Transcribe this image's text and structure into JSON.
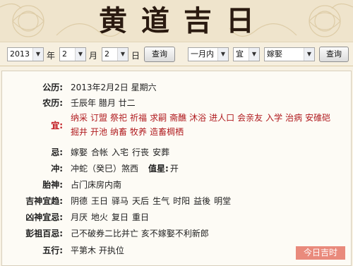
{
  "header": {
    "title": "黄道吉日"
  },
  "query": {
    "year": "2013",
    "year_unit": "年",
    "month": "2",
    "month_unit": "月",
    "day": "2",
    "day_unit": "日",
    "query_button": "查询",
    "range": "一月内",
    "type": "宜",
    "event": "嫁娶",
    "query_button2": "查询"
  },
  "result": {
    "gongli": {
      "label": "公历:",
      "value": "2013年2月2日 星期六"
    },
    "nongli": {
      "label": "农历:",
      "value": "壬辰年 腊月 廿二"
    },
    "yi": {
      "label": "宜:",
      "items": [
        "纳采",
        "订盟",
        "祭祀",
        "祈福",
        "求嗣",
        "斋醮",
        "沐浴",
        "进人口",
        "会亲友",
        "入学",
        "治病",
        "安碓硙",
        "掘井",
        "开池",
        "纳畜",
        "牧养",
        "造畜椆栖"
      ]
    },
    "ji": {
      "label": "忌:",
      "items": [
        "嫁娶",
        "合帐",
        "入宅",
        "行丧",
        "安葬"
      ]
    },
    "chong": {
      "label": "冲:",
      "value": "冲蛇（癸巳）煞西",
      "zhixing_label": "值星:",
      "zhixing_value": "开"
    },
    "taishen": {
      "label": "胎神:",
      "value": "占门床房内南"
    },
    "jishen": {
      "label": "吉神宜趋:",
      "items": [
        "阴德",
        "王日",
        "驿马",
        "天后",
        "生气",
        "时阳",
        "益後",
        "明堂"
      ]
    },
    "xiongshen": {
      "label": "凶神宜忌:",
      "items": [
        "月厌",
        "地火",
        "复日",
        "重日"
      ]
    },
    "pengzu": {
      "label": "彭祖百忌:",
      "value": "己不破券二比并亡  亥不嫁娶不利新郎"
    },
    "wuxing": {
      "label": "五行:",
      "value": "平第木  开执位"
    }
  },
  "badge": "今日吉时"
}
